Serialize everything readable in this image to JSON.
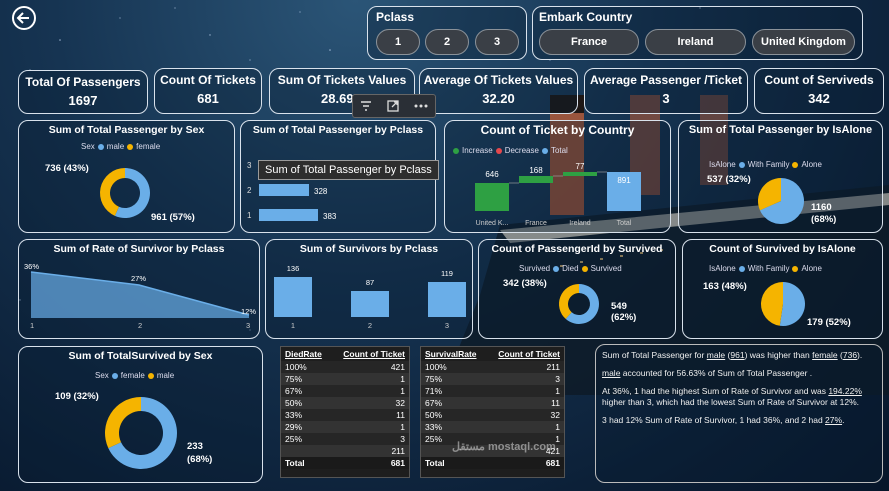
{
  "pclass_slicer": {
    "title": "Pclass",
    "options": [
      "1",
      "2",
      "3"
    ]
  },
  "embark_slicer": {
    "title": "Embark Country",
    "options": [
      "France",
      "Ireland",
      "United Kingdom"
    ]
  },
  "kpis": [
    {
      "label": "Total Of Passengers",
      "value": "1697"
    },
    {
      "label": "Count Of Tickets",
      "value": "681"
    },
    {
      "label": "Sum Of Tickets Values",
      "value": "28.69K"
    },
    {
      "label": "Average Of Tickets Values",
      "value": "32.20"
    },
    {
      "label": "Average Passenger /Ticket",
      "value": "3"
    },
    {
      "label": "Count of Serviveds",
      "value": "342"
    }
  ],
  "visual_toolbar": {
    "icons": [
      "filter-icon",
      "focus-mode-icon",
      "more-options-icon"
    ]
  },
  "tooltip": {
    "text": "Sum of Total Passenger  by Pclass"
  },
  "sex_passenger": {
    "title": "Sum of Total Passenger by Sex",
    "legend_title": "Sex",
    "legend": [
      "male",
      "female"
    ],
    "labels": [
      "736 (43%)",
      "961 (57%)"
    ],
    "colors": {
      "male": "#6aaee8",
      "female": "#f5b400"
    }
  },
  "pclass_passenger": {
    "title": "Sum of Total Passenger by Pclass",
    "axis": [
      "3",
      "2",
      "1"
    ],
    "bar_labels": [
      "",
      "328",
      "383"
    ]
  },
  "ticket_country": {
    "title": "Count of Ticket by Country",
    "legend": [
      "Increase",
      "Decrease",
      "Total"
    ],
    "values": [
      "646",
      "168",
      "77",
      "891"
    ],
    "categories": [
      "United K...",
      "France",
      "Ireland",
      "Total"
    ]
  },
  "isalone_passenger": {
    "title": "Sum of Total Passenger by IsAlone",
    "legend_title": "IsAlone",
    "legend": [
      "With Family",
      "Alone"
    ],
    "labels": [
      "537 (32%)",
      "1160",
      "(68%)"
    ]
  },
  "rate_survivor": {
    "title": "Sum of Rate of Survivor by Pclass",
    "point_labels": [
      "36%",
      "27%",
      "12%"
    ],
    "axis": [
      "1",
      "2",
      "3"
    ]
  },
  "survivors_pclass": {
    "title": "Sum of Survivors by Pclass",
    "values": [
      "136",
      "87",
      "119"
    ],
    "axis": [
      "1",
      "2",
      "3"
    ]
  },
  "passengerid_survived": {
    "title": "Count of PassengerId by Survived",
    "legend_title": "Survived",
    "legend": [
      "Died",
      "Survived"
    ],
    "labels": [
      "342 (38%)",
      "549",
      "(62%)"
    ]
  },
  "survived_isalone": {
    "title": "Count of Survived by IsAlone",
    "legend_title": "IsAlone",
    "legend": [
      "With Family",
      "Alone"
    ],
    "labels": [
      "163 (48%)",
      "179 (52%)"
    ]
  },
  "totalsurvived_sex": {
    "title": "Sum of TotalSurvived by Sex",
    "legend_title": "Sex",
    "legend": [
      "female",
      "male"
    ],
    "labels": [
      "109 (32%)",
      "233",
      "(68%)"
    ]
  },
  "died_table": {
    "headers": [
      "DiedRate",
      "Count of Ticket"
    ],
    "rows": [
      [
        "100%",
        "421"
      ],
      [
        "75%",
        "1"
      ],
      [
        "67%",
        "1"
      ],
      [
        "50%",
        "32"
      ],
      [
        "33%",
        "11"
      ],
      [
        "29%",
        "1"
      ],
      [
        "25%",
        "3"
      ],
      [
        "",
        "211"
      ]
    ],
    "total": [
      "Total",
      "681"
    ]
  },
  "survival_table": {
    "headers": [
      "SurvivalRate",
      "Count of Ticket"
    ],
    "rows": [
      [
        "100%",
        "211"
      ],
      [
        "75%",
        "3"
      ],
      [
        "71%",
        "1"
      ],
      [
        "67%",
        "11"
      ],
      [
        "50%",
        "32"
      ],
      [
        "33%",
        "1"
      ],
      [
        "25%",
        "1"
      ],
      [
        "",
        "421"
      ]
    ],
    "total": [
      "Total",
      "681"
    ]
  },
  "narrative": {
    "p1a": "Sum of Total Passenger  for ",
    "p1b": "male",
    "p1c": " (",
    "p1d": "961",
    "p1e": ") was higher than ",
    "p1f": "female",
    "p1g": " (",
    "p1h": "736",
    "p1i": ").",
    "p2a": "male",
    "p2b": " accounted for 56.63% of Sum of Total Passenger .",
    "p3a": "At 36%, 1 had the highest Sum of Rate of Survivor and was ",
    "p3b": "194.22%",
    "p3c": " higher than 3, which had the lowest Sum of Rate of Survivor at 12%.",
    "p4a": "3 had 12% Sum of Rate of Survivor, 1 had 36%, and 2 had ",
    "p4b": "27%",
    "p4c": "."
  },
  "watermark": "مستقل mostaql.com",
  "chart_data": [
    {
      "type": "pie",
      "title": "Sum of Total Passenger by Sex",
      "categories": [
        "male",
        "female"
      ],
      "values": [
        961,
        736
      ]
    },
    {
      "type": "bar",
      "title": "Sum of Total Passenger by Pclass",
      "categories": [
        "1",
        "2",
        "3"
      ],
      "values": [
        383,
        328,
        null
      ]
    },
    {
      "type": "bar",
      "title": "Count of Ticket by Country",
      "categories": [
        "United K...",
        "France",
        "Ireland",
        "Total"
      ],
      "values": [
        646,
        168,
        77,
        891
      ]
    },
    {
      "type": "pie",
      "title": "Sum of Total Passenger by IsAlone",
      "categories": [
        "With Family",
        "Alone"
      ],
      "values": [
        1160,
        537
      ]
    },
    {
      "type": "area",
      "title": "Sum of Rate of Survivor by Pclass",
      "categories": [
        "1",
        "2",
        "3"
      ],
      "values": [
        36,
        27,
        12
      ]
    },
    {
      "type": "bar",
      "title": "Sum of Survivors by Pclass",
      "categories": [
        "1",
        "2",
        "3"
      ],
      "values": [
        136,
        87,
        119
      ]
    },
    {
      "type": "pie",
      "title": "Count of PassengerId by Survived",
      "categories": [
        "Died",
        "Survived"
      ],
      "values": [
        549,
        342
      ]
    },
    {
      "type": "pie",
      "title": "Count of Survived by IsAlone",
      "categories": [
        "With Family",
        "Alone"
      ],
      "values": [
        179,
        163
      ]
    },
    {
      "type": "pie",
      "title": "Sum of TotalSurvived by Sex",
      "categories": [
        "female",
        "male"
      ],
      "values": [
        233,
        109
      ]
    }
  ]
}
